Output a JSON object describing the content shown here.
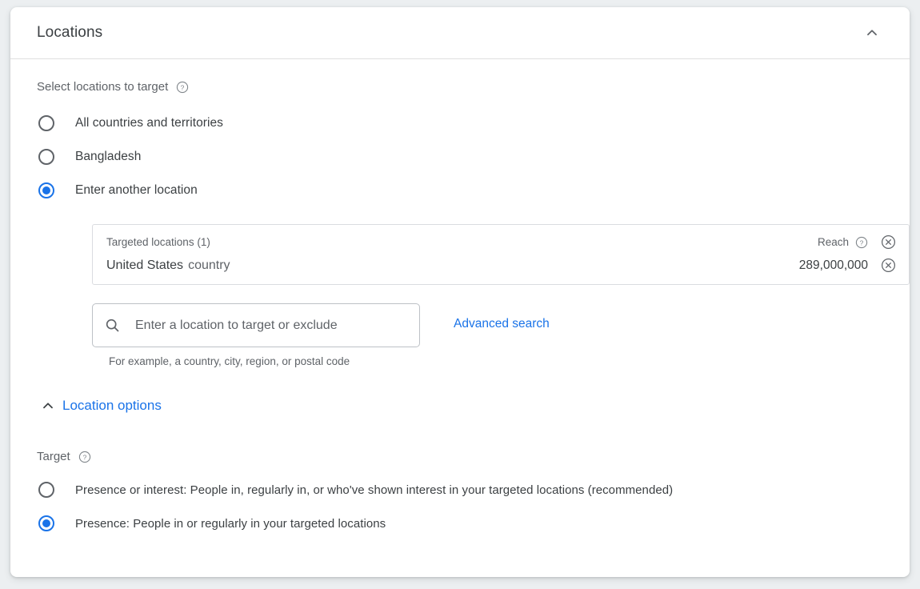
{
  "header": {
    "title": "Locations",
    "collapse_icon": "chevron-up-icon"
  },
  "target_section": {
    "label": "Select locations to target",
    "help_icon": "help-icon",
    "options": [
      {
        "label": "All countries and territories",
        "selected": false
      },
      {
        "label": "Bangladesh",
        "selected": false
      },
      {
        "label": "Enter another location",
        "selected": true
      }
    ]
  },
  "targeted_locations": {
    "header_label": "Targeted locations (1)",
    "reach_label": "Reach",
    "reach_help_icon": "help-icon",
    "header_remove_icon": "remove-circle-icon",
    "rows": [
      {
        "name": "United States",
        "type": "country",
        "reach": "289,000,000",
        "remove_icon": "remove-circle-icon"
      }
    ]
  },
  "search": {
    "icon": "search-icon",
    "placeholder": "Enter a location to target or exclude",
    "value": "",
    "hint": "For example, a country, city, region, or postal code",
    "advanced_link": "Advanced search"
  },
  "location_options": {
    "toggle_icon": "chevron-up-icon",
    "label": "Location options",
    "target": {
      "label": "Target",
      "help_icon": "help-icon",
      "options": [
        {
          "label": "Presence or interest: People in, regularly in, or who've shown interest in your targeted locations (recommended)",
          "selected": false
        },
        {
          "label": "Presence: People in or regularly in your targeted locations",
          "selected": true
        }
      ]
    }
  },
  "colors": {
    "accent": "#1a73e8",
    "text_primary": "#3c4043",
    "text_secondary": "#5f6368",
    "border": "#dadce0",
    "page_background": "#eceff1"
  }
}
